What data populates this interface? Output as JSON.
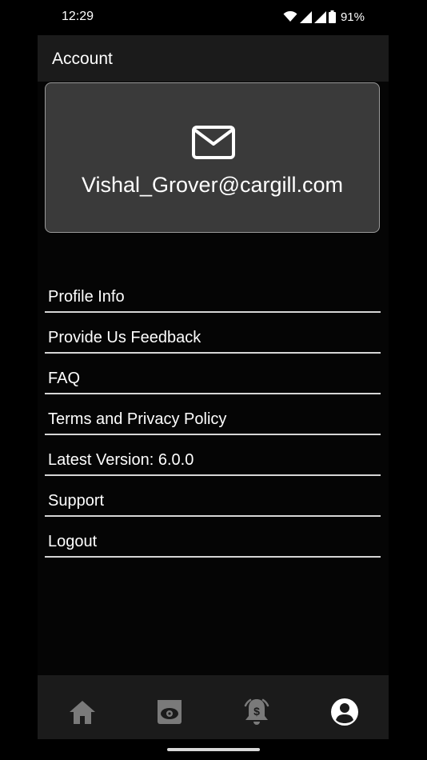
{
  "status_bar": {
    "time": "12:29",
    "battery": "91%",
    "icons": [
      "wifi-icon",
      "signal-icon",
      "signal-icon",
      "battery-icon"
    ]
  },
  "header": {
    "title": "Account"
  },
  "account_card": {
    "icon": "mail-icon",
    "email": "Vishal_Grover@cargill.com"
  },
  "menu": {
    "items": [
      {
        "label": "Profile Info"
      },
      {
        "label": "Provide Us Feedback"
      },
      {
        "label": "FAQ"
      },
      {
        "label": "Terms and Privacy Policy"
      },
      {
        "label": "Latest Version: 6.0.0"
      },
      {
        "label": "Support"
      },
      {
        "label": "Logout"
      }
    ]
  },
  "bottom_nav": {
    "items": [
      {
        "icon": "home-icon",
        "active": false
      },
      {
        "icon": "watch-icon",
        "active": false
      },
      {
        "icon": "price-alert-icon",
        "active": false
      },
      {
        "icon": "account-icon",
        "active": true
      }
    ]
  },
  "colors": {
    "background": "#000000",
    "panel": "#1b1b1b",
    "card": "#3a3a3a",
    "active_icon": "#ffffff",
    "inactive_icon": "#7a7a7a"
  }
}
